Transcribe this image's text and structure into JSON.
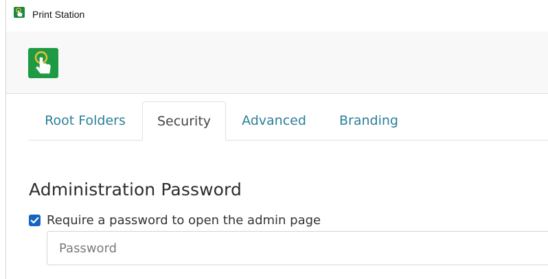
{
  "window": {
    "title": "Print Station",
    "icon": "print-station-touch-icon"
  },
  "header": {
    "logo_icon": "touch-hand-icon",
    "accent_color": "#1e9a44"
  },
  "tabs": [
    {
      "label": "Root Folders",
      "active": false
    },
    {
      "label": "Security",
      "active": true
    },
    {
      "label": "Advanced",
      "active": false
    },
    {
      "label": "Branding",
      "active": false
    }
  ],
  "admin_password": {
    "heading": "Administration Password",
    "require_checkbox": {
      "label": "Require a password to open the admin page",
      "checked": true
    },
    "password_field": {
      "placeholder": "Password",
      "value": ""
    }
  },
  "colors": {
    "tab_link": "#2a7f99",
    "checkbox": "#1565c0"
  }
}
